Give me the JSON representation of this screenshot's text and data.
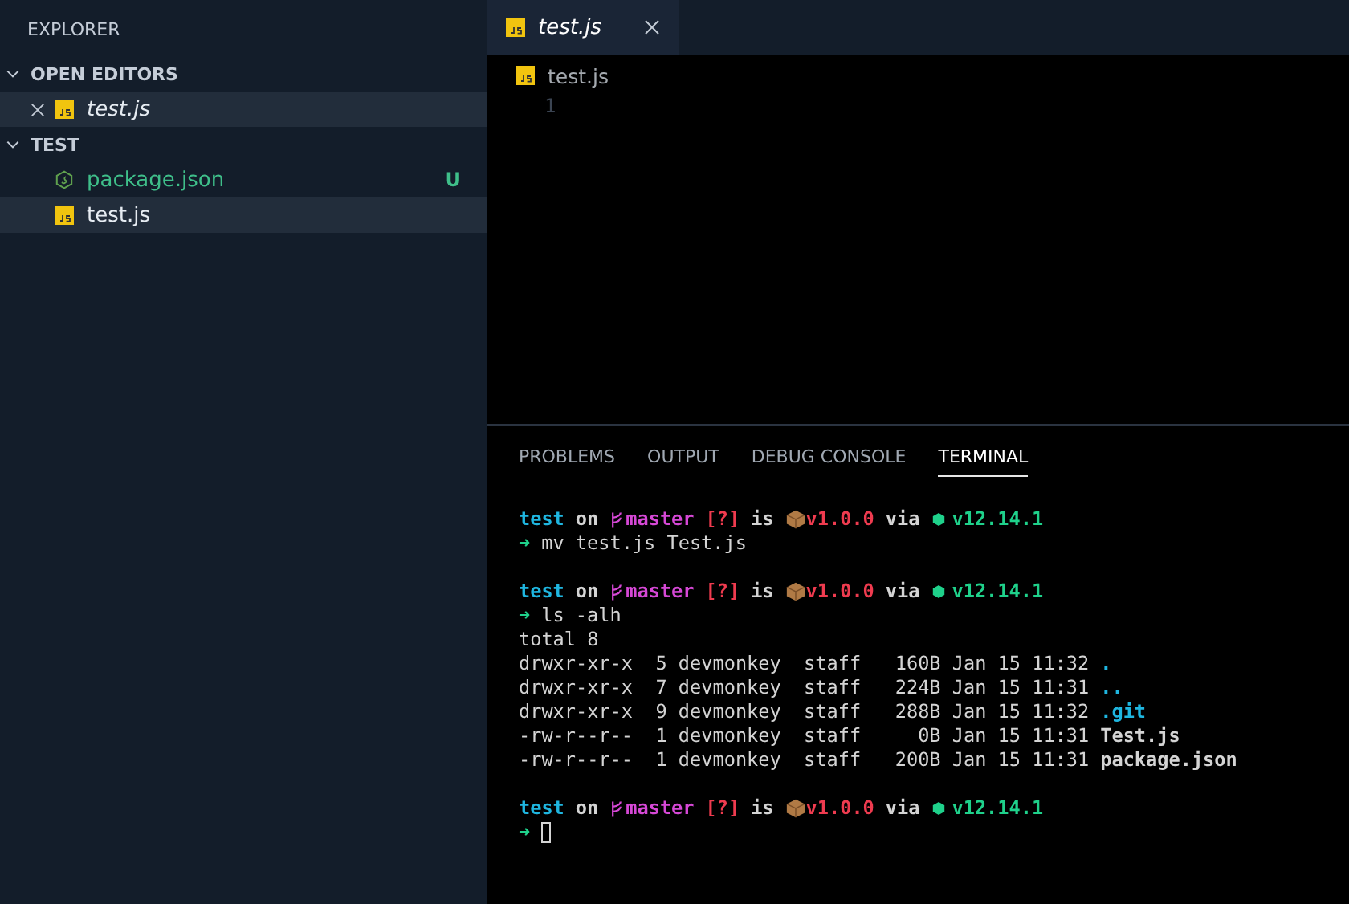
{
  "sidebar": {
    "title": "EXPLORER",
    "sections": [
      {
        "title": "OPEN EDITORS",
        "expanded": true,
        "items": [
          {
            "name": "test.js",
            "kind": "js",
            "preview": true,
            "closable": true,
            "selected": true
          }
        ]
      },
      {
        "title": "TEST",
        "expanded": true,
        "items": [
          {
            "name": "package.json",
            "kind": "node",
            "preview": false,
            "git": "U",
            "selected": false
          },
          {
            "name": "test.js",
            "kind": "js",
            "preview": false,
            "selected": true
          }
        ]
      }
    ]
  },
  "tabs": [
    {
      "name": "test.js",
      "kind": "js",
      "preview": true,
      "selected": true
    }
  ],
  "breadcrumb": {
    "name": "test.js",
    "kind": "js"
  },
  "editor": {
    "line_numbers": [
      "1"
    ]
  },
  "panel": {
    "tabs": [
      {
        "label": "PROBLEMS",
        "selected": false
      },
      {
        "label": "OUTPUT",
        "selected": false
      },
      {
        "label": "DEBUG CONSOLE",
        "selected": false
      },
      {
        "label": "TERMINAL",
        "selected": true
      }
    ],
    "terminal": [
      {
        "kind": "prompt",
        "dir": "test",
        "on": "on",
        "branch": "master",
        "status": "[?]",
        "is": "is",
        "version": "v1.0.0",
        "via": "via",
        "node": "v12.14.1"
      },
      {
        "kind": "command",
        "arrow": "➜",
        "text": "mv test.js Test.js"
      },
      {
        "kind": "blank"
      },
      {
        "kind": "prompt",
        "dir": "test",
        "on": "on",
        "branch": "master",
        "status": "[?]",
        "is": "is",
        "version": "v1.0.0",
        "via": "via",
        "node": "v12.14.1"
      },
      {
        "kind": "command",
        "arrow": "➜",
        "text": "ls -alh"
      },
      {
        "kind": "output",
        "text": "total 8"
      },
      {
        "kind": "entry",
        "info": "drwxr-xr-x  5 devmonkey  staff   160B Jan 15 11:32",
        "name": ".",
        "color": "#1fb6e0"
      },
      {
        "kind": "entry",
        "info": "drwxr-xr-x  7 devmonkey  staff   224B Jan 15 11:31",
        "name": "..",
        "color": "#1fb6e0"
      },
      {
        "kind": "entry",
        "info": "drwxr-xr-x  9 devmonkey  staff   288B Jan 15 11:32",
        "name": ".git",
        "color": "#1fb6e0"
      },
      {
        "kind": "entry",
        "info": "-rw-r--r--  1 devmonkey  staff     0B Jan 15 11:31",
        "name": "Test.js",
        "color": "#d4d4d4"
      },
      {
        "kind": "entry",
        "info": "-rw-r--r--  1 devmonkey  staff   200B Jan 15 11:31",
        "name": "package.json",
        "color": "#d4d4d4"
      },
      {
        "kind": "blank"
      },
      {
        "kind": "prompt",
        "dir": "test",
        "on": "on",
        "branch": "master",
        "status": "[?]",
        "is": "is",
        "version": "v1.0.0",
        "via": "via",
        "node": "v12.14.1"
      },
      {
        "kind": "cursor",
        "arrow": "➜"
      }
    ]
  }
}
